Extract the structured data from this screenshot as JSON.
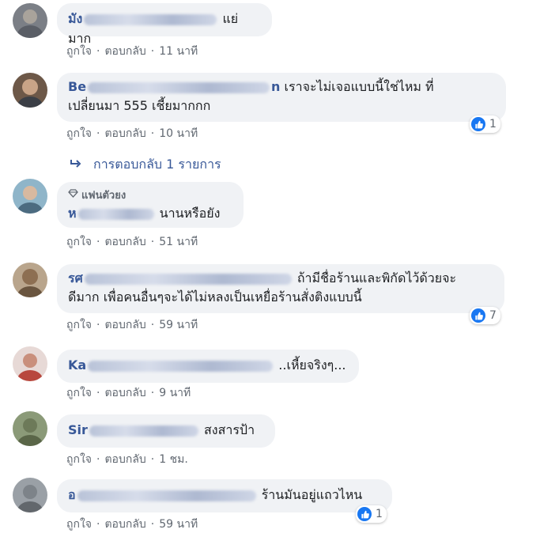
{
  "actions": {
    "like": "ถูกใจ",
    "reply": "ตอบกลับ",
    "sep": "·"
  },
  "comments": [
    {
      "name": "มัง",
      "text": "แย่มาก",
      "time": "11 นาที"
    },
    {
      "name": "Be",
      "name_tail": "n",
      "text1": "เราจะไม่เจอแบบนี้ใช่ไหม ที่",
      "text2": "เปลี่ยนมา 555 เชี้ยมากกก",
      "time": "10 นาที",
      "reactions": "1",
      "replies_link": "การตอบกลับ 1 รายการ"
    },
    {
      "badge": "แฟนตัวยง",
      "name": "ห",
      "text": "นานหรือยัง",
      "time": "51 นาที"
    },
    {
      "name": "รศ",
      "text1": "ถ้ามีชื่อร้านและพิกัดไว้ด้วยจะ",
      "text2": "ดีมาก เพื่อคนอื่นๆจะได้ไม่หลงเป็นเหยื่อร้านสั่งติงแบบนี้",
      "time": "59 นาที",
      "reactions": "7"
    },
    {
      "name": "Ka",
      "text": "..เหี้ยจริงๆ...",
      "time": "9 นาที"
    },
    {
      "name": "Sir",
      "text": "สงสารป้า",
      "time": "1 ชม."
    },
    {
      "name": "อ",
      "text": "ร้านมันอยู่แถวไหน",
      "time": "59 นาที",
      "reactions": "1"
    }
  ],
  "colors": {
    "link": "#385898",
    "bubble": "#f0f2f5",
    "like": "#1877f2",
    "meta": "#606770"
  }
}
